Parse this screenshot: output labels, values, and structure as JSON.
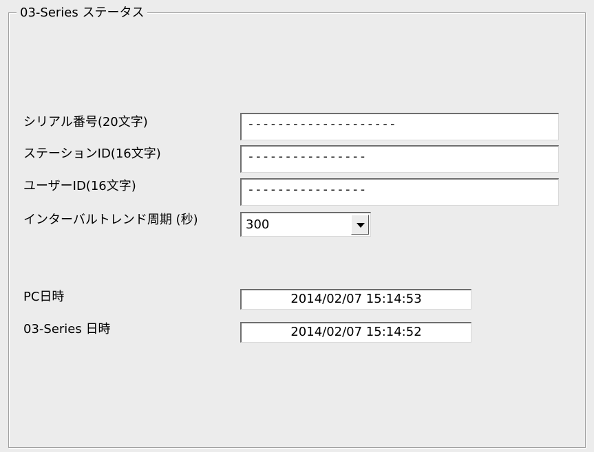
{
  "group": {
    "title": "03-Series ステータス"
  },
  "fields": {
    "serial": {
      "label": "シリアル番号(20文字)",
      "value": "--------------------"
    },
    "station_id": {
      "label": "ステーションID(16文字)",
      "value": "----------------"
    },
    "user_id": {
      "label": "ユーザーID(16文字)",
      "value": "----------------"
    },
    "interval": {
      "label": "インターバルトレンド周期 (秒)",
      "value": "300"
    }
  },
  "clock": {
    "pc": {
      "label": "PC日時",
      "value": "2014/02/07 15:14:53"
    },
    "device": {
      "label": "03-Series 日時",
      "value": "2014/02/07 15:14:52"
    }
  }
}
